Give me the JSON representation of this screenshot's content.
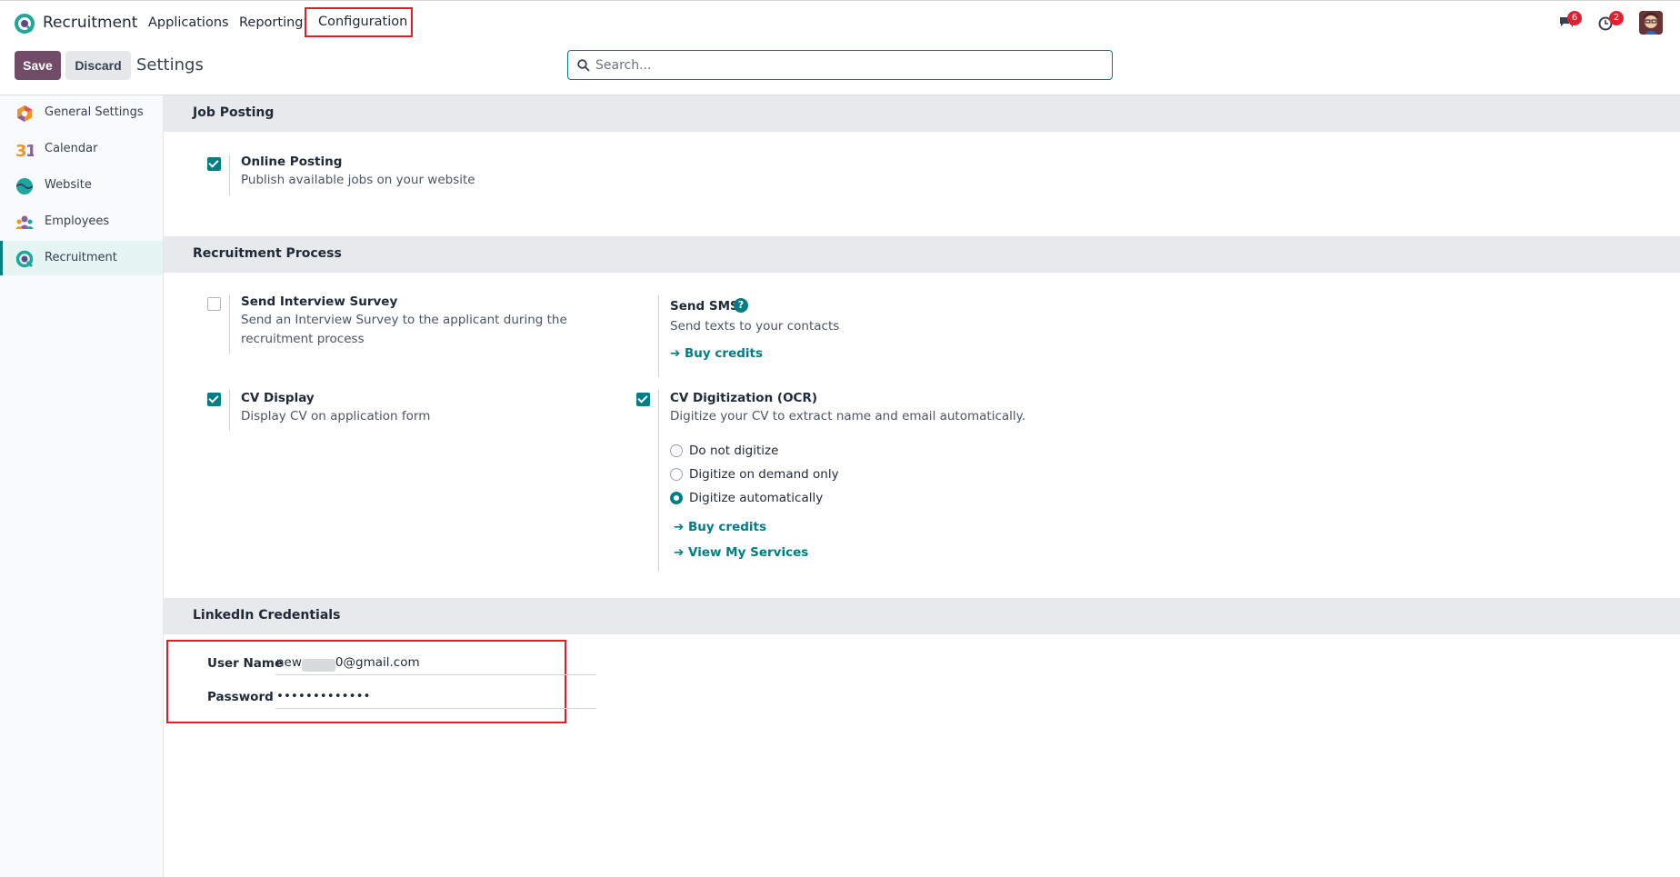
{
  "topbar": {
    "app_name": "Recruitment",
    "menu": [
      "Applications",
      "Reporting",
      "Configuration"
    ],
    "messages_icon": "chat-bubbles-icon",
    "messages_count": "6",
    "activities_icon": "clock-icon",
    "activities_count": "2",
    "avatar_icon": "user-avatar"
  },
  "controls": {
    "save_label": "Save",
    "discard_label": "Discard",
    "page_title": "Settings",
    "search_placeholder": "Search..."
  },
  "sidebar": {
    "items": [
      {
        "label": "General Settings",
        "icon": "general-settings-icon"
      },
      {
        "label": "Calendar",
        "icon": "calendar-icon"
      },
      {
        "label": "Website",
        "icon": "website-icon"
      },
      {
        "label": "Employees",
        "icon": "employees-icon"
      },
      {
        "label": "Recruitment",
        "icon": "recruitment-icon",
        "active": true
      }
    ]
  },
  "sections": {
    "job_posting": {
      "title": "Job Posting",
      "online_posting": {
        "title": "Online Posting",
        "desc": "Publish available jobs on your website",
        "checked": true
      }
    },
    "recruitment_process": {
      "title": "Recruitment Process",
      "interview_survey": {
        "title": "Send Interview Survey",
        "desc_line1": "Send an Interview Survey to the applicant during the",
        "desc_line2": "recruitment process",
        "checked": false
      },
      "send_sms": {
        "title": "Send SMS",
        "desc": "Send texts to your contacts",
        "link": "Buy credits"
      },
      "cv_display": {
        "title": "CV Display",
        "desc": "Display CV on application form",
        "checked": true
      },
      "cv_ocr": {
        "title": "CV Digitization (OCR)",
        "desc": "Digitize your CV to extract name and email automatically.",
        "checked": true,
        "options": [
          "Do not digitize",
          "Digitize on demand only",
          "Digitize automatically"
        ],
        "selected": "Digitize automatically",
        "link_credits": "Buy credits",
        "link_services": "View My Services"
      }
    },
    "linkedin": {
      "title": "LinkedIn Credentials",
      "username_label": "User Name",
      "username_prefix": "new",
      "username_suffix": "0@gmail.com",
      "password_label": "Password",
      "password_value": "•••••••••••••"
    }
  },
  "colors": {
    "primary": "#714b67",
    "accent": "#017e84",
    "highlight": "#e11d2a",
    "badge": "#e1212f"
  }
}
